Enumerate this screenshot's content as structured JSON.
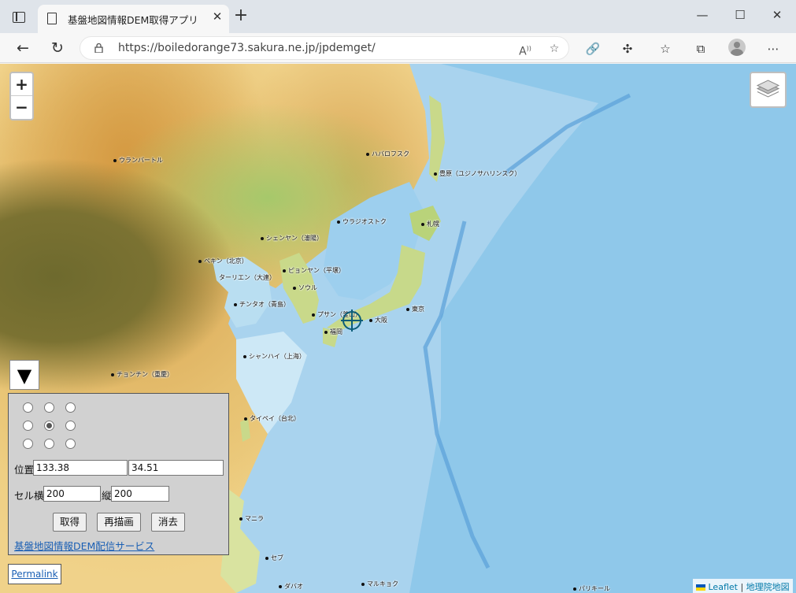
{
  "browser": {
    "tab_title": "基盤地図情報DEM取得アプリ",
    "url": "https://boiledorange73.sakura.ne.jp/jpdemget/"
  },
  "map": {
    "zoom_in": "+",
    "zoom_out": "−",
    "labels": [
      {
        "name": "ウランバートル"
      },
      {
        "name": "ハバロフスク"
      },
      {
        "name": "豊原（ユジノサハリンスク）"
      },
      {
        "name": "ウラジオストク"
      },
      {
        "name": "札幌"
      },
      {
        "name": "シェンヤン（瀋陽）"
      },
      {
        "name": "ペキン（北京）"
      },
      {
        "name": "ピョンヤン（平壌）"
      },
      {
        "name": "ターリエン（大連）"
      },
      {
        "name": "ソウル"
      },
      {
        "name": "チンタオ（青島）"
      },
      {
        "name": "東京"
      },
      {
        "name": "プサン（釜山）"
      },
      {
        "name": "大阪"
      },
      {
        "name": "福岡"
      },
      {
        "name": "シャンハイ（上海）"
      },
      {
        "name": "チョンチン（重慶）"
      },
      {
        "name": "タイペイ（台北）"
      },
      {
        "name": "マニラ"
      },
      {
        "name": "セブ"
      },
      {
        "name": "ダバオ"
      },
      {
        "name": "マルキョク"
      },
      {
        "name": "パリキール"
      }
    ]
  },
  "panel": {
    "toggle_symbol": "▼",
    "selected_anchor": "center",
    "position_label": "位置",
    "lon": "133.38",
    "lat": "34.51",
    "cell_w_label": "セル横",
    "cell_w": "200",
    "cell_h_label": "縦",
    "cell_h": "200",
    "btn_get": "取得",
    "btn_redraw": "再描画",
    "btn_clear": "消去",
    "service_link": "基盤地図情報DEM配信サービス"
  },
  "permalink": "Permalink",
  "attribution": {
    "leaflet": "Leaflet",
    "separator": " | ",
    "gsi": "地理院地図"
  }
}
